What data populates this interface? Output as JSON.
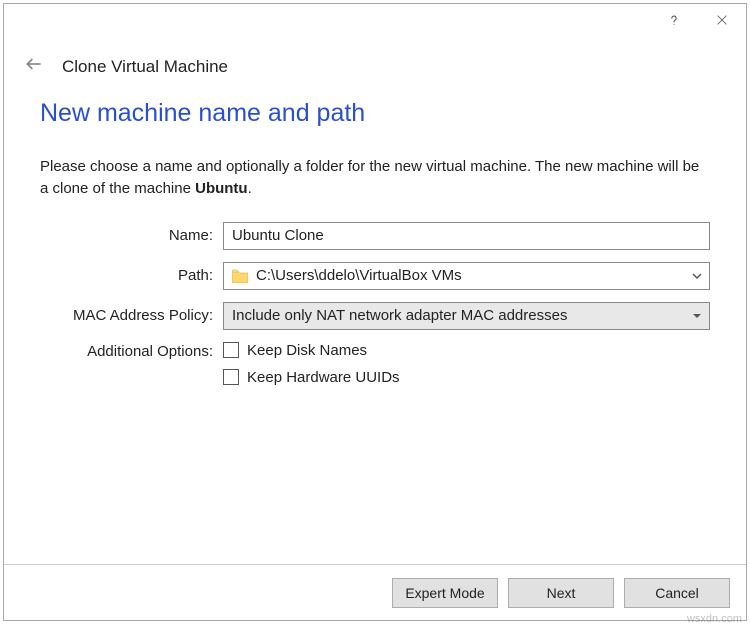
{
  "titlebar": {
    "help_tooltip": "Help",
    "close_tooltip": "Close"
  },
  "header": {
    "wizard_title": "Clone Virtual Machine"
  },
  "page": {
    "title": "New machine name and path",
    "intro_prefix": "Please choose a name and optionally a folder for the new virtual machine. The new machine will be a clone of the machine ",
    "intro_machine": "Ubuntu",
    "intro_suffix": "."
  },
  "form": {
    "name_label": "Name:",
    "name_value": "Ubuntu Clone",
    "path_label": "Path:",
    "path_value": "C:\\Users\\ddelo\\VirtualBox VMs",
    "mac_label": "MAC Address Policy:",
    "mac_value": "Include only NAT network adapter MAC addresses",
    "options_label": "Additional Options:",
    "keep_disk_names": "Keep Disk Names",
    "keep_hardware_uuids": "Keep Hardware UUIDs"
  },
  "footer": {
    "expert_mode": "Expert Mode",
    "next": "Next",
    "cancel": "Cancel"
  },
  "watermark": "wsxdn.com"
}
